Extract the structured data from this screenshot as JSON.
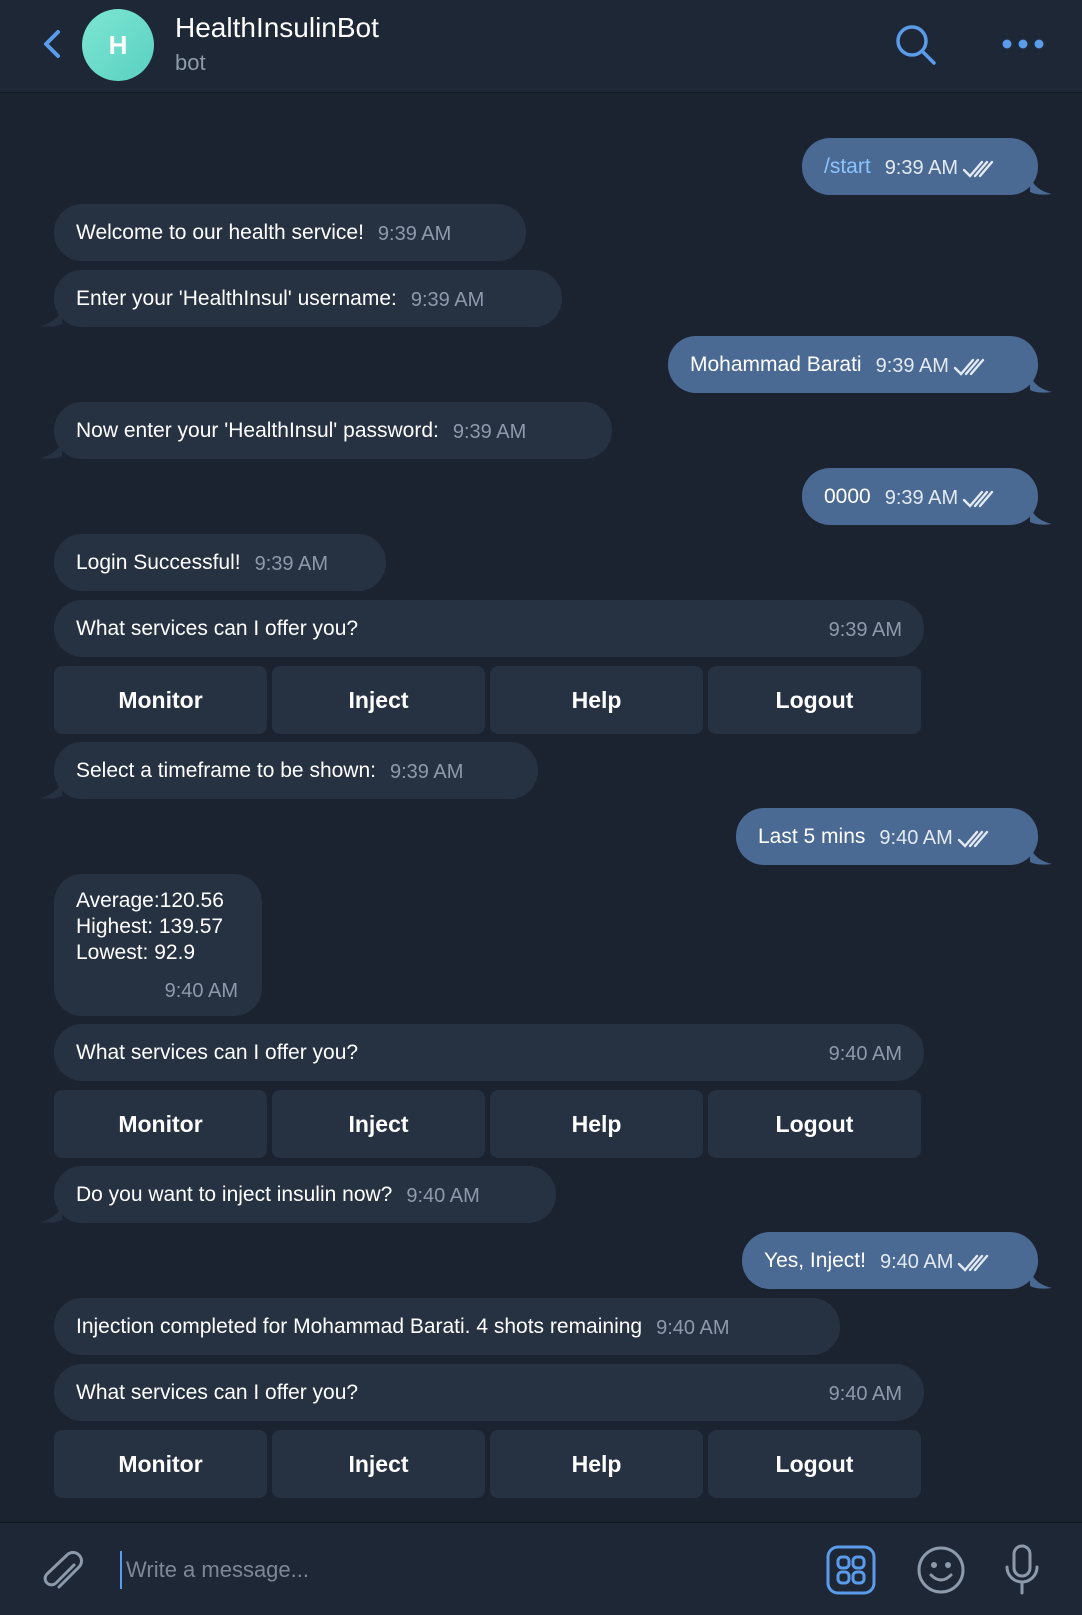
{
  "header": {
    "avatar_letter": "H",
    "title": "HealthInsulinBot",
    "subtitle": "bot"
  },
  "messages": [
    {
      "dir": "out",
      "text": "/start",
      "time": "9:39 AM",
      "command": true
    },
    {
      "dir": "in",
      "text": "Welcome to our health service!",
      "time": "9:39 AM"
    },
    {
      "dir": "in",
      "text": "Enter your 'HealthInsul' username:",
      "time": "9:39 AM"
    },
    {
      "dir": "out",
      "text": "Mohammad Barati",
      "time": "9:39 AM"
    },
    {
      "dir": "in",
      "text": "Now enter your 'HealthInsul' password:",
      "time": "9:39 AM"
    },
    {
      "dir": "out",
      "text": "0000",
      "time": "9:39 AM"
    },
    {
      "dir": "in",
      "text": "Login Successful!",
      "time": "9:39 AM"
    },
    {
      "dir": "in",
      "text": "What services can I offer you?",
      "time": "9:39 AM"
    },
    {
      "dir": "in",
      "text": "Select a timeframe to be shown:",
      "time": "9:39 AM"
    },
    {
      "dir": "out",
      "text": "Last 5 mins",
      "time": "9:40 AM"
    },
    {
      "dir": "in",
      "lines": [
        "Average:120.56",
        "Highest: 139.57",
        "Lowest: 92.9"
      ],
      "time": "9:40 AM"
    },
    {
      "dir": "in",
      "text": "What services can I offer you?",
      "time": "9:40 AM"
    },
    {
      "dir": "in",
      "text": "Do you want to inject insulin now?",
      "time": "9:40 AM"
    },
    {
      "dir": "out",
      "text": "Yes, Inject!",
      "time": "9:40 AM"
    },
    {
      "dir": "in",
      "text": "Injection completed for Mohammad Barati. 4 shots remaining",
      "time": "9:40 AM"
    },
    {
      "dir": "in",
      "text": "What services can I offer you?",
      "time": "9:40 AM"
    }
  ],
  "keyboard": [
    "Monitor",
    "Inject",
    "Help",
    "Logout"
  ],
  "composer": {
    "placeholder": "Write a message..."
  },
  "colors": {
    "background": "#1b2330",
    "incoming_bubble": "#263142",
    "outgoing_bubble": "#4a6a93",
    "accent": "#5a9bea"
  },
  "icons": [
    "back-chevron-icon",
    "search-icon",
    "more-icon",
    "attach-icon",
    "bot-commands-icon",
    "emoji-icon",
    "microphone-icon",
    "double-check-icon"
  ]
}
